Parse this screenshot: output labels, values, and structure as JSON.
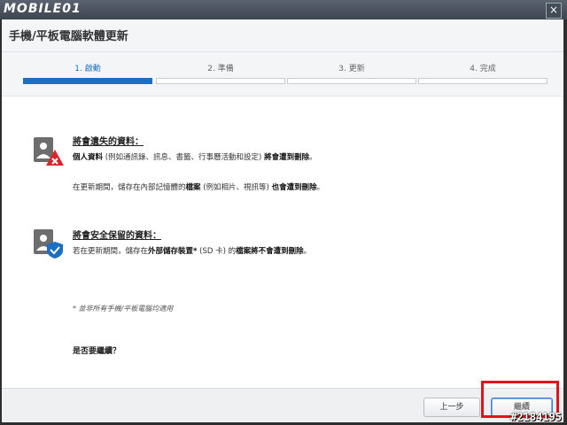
{
  "header": {
    "logo_text": "MOBILE01",
    "close_label": "×"
  },
  "dialog": {
    "title": "手機/平板電腦軟體更新"
  },
  "steps": [
    {
      "label": "1. 啟動",
      "active": true
    },
    {
      "label": "2. 準備",
      "active": false
    },
    {
      "label": "3. 更新",
      "active": false
    },
    {
      "label": "4. 完成",
      "active": false
    }
  ],
  "section_lost": {
    "title": "將會遺失的資料：",
    "line1_bold": "個人資料",
    "line1_plain": " (例如通訊錄、訊息、書籤、行事曆活動和設定) ",
    "line1_bold2": "將會遭到刪除",
    "line1_end": "。",
    "line2_plain": "在更新期間，儲存在內部記憶體的",
    "line2_bold": "檔案",
    "line2_plain2": " (例如相片、視訊等) ",
    "line2_bold2": "也會遭到刪除",
    "line2_end": "。"
  },
  "section_safe": {
    "title": "將會安全保留的資料：",
    "line_plain": "若在更新期間，儲存在",
    "line_bold": "外部儲存裝置*",
    "line_plain2": " (SD 卡) 的",
    "line_bold2": "檔案將不會遭到刪除",
    "line_end": "。"
  },
  "note": "* 並非所有手機/平板電腦均適用",
  "question": "是否要繼續？",
  "buttons": {
    "back": "上一步",
    "continue": "繼續"
  },
  "watermark": "#2184195",
  "colors": {
    "accent": "#1a6fc4",
    "highlight": "#e0151b",
    "warning_badge": "#d9262c",
    "safe_badge": "#1a6fc4"
  }
}
